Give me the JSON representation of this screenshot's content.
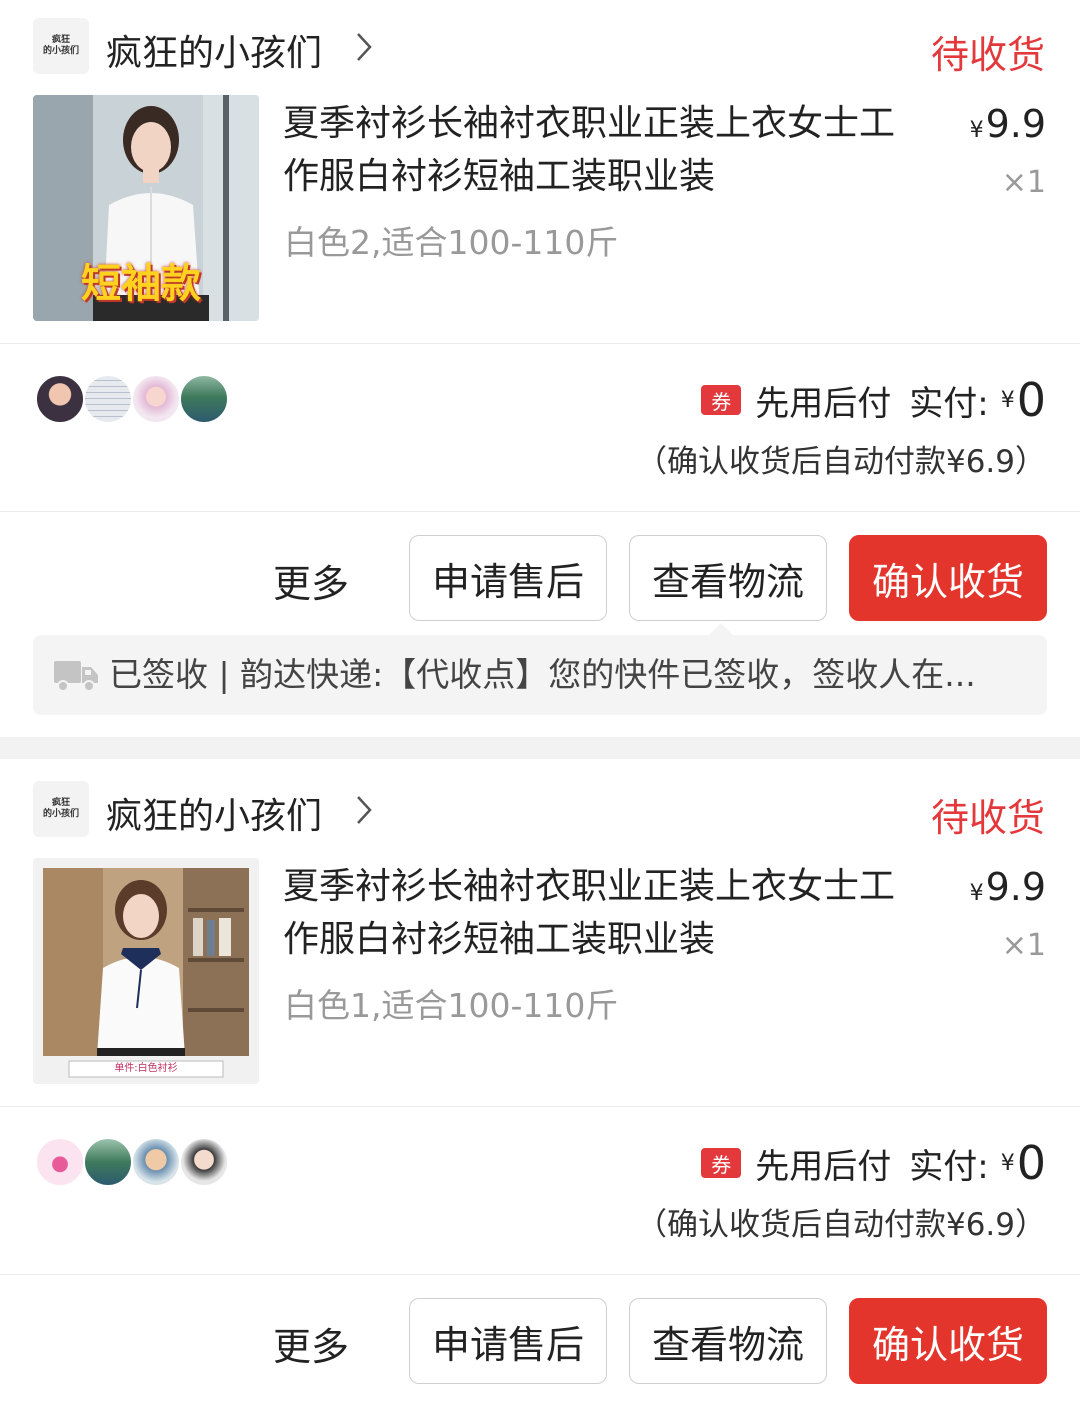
{
  "orders": [
    {
      "shop": {
        "logo_text": "疯狂\n的小孩们",
        "name": "疯狂的小孩们"
      },
      "status": "待收货",
      "product": {
        "title": "夏季衬衫长袖衬衣职业正装上衣女士工作服白衬衫短袖工装职业装",
        "variant": "白色2,适合100-110斤",
        "price_symbol": "¥",
        "price": "9.9",
        "quantity": "×1",
        "image_overlay_text": "短袖款"
      },
      "payment": {
        "coupon_badge": "券",
        "method": "先用后付",
        "actual_label": "实付:",
        "currency": "¥",
        "actual_value": "0",
        "auto_pay_note": "（确认收货后自动付款¥6.9）"
      },
      "actions": {
        "more": "更多",
        "after_sales": "申请售后",
        "logistics": "查看物流",
        "confirm": "确认收货"
      },
      "logistics_summary": "已签收 | 韵达快递:【代收点】您的快件已签收，签收人在..."
    },
    {
      "shop": {
        "logo_text": "疯狂\n的小孩们",
        "name": "疯狂的小孩们"
      },
      "status": "待收货",
      "product": {
        "title": "夏季衬衫长袖衬衣职业正装上衣女士工作服白衬衫短袖工装职业装",
        "variant": "白色1,适合100-110斤",
        "price_symbol": "¥",
        "price": "9.9",
        "quantity": "×1",
        "image_caption": "单件:白色衬衫"
      },
      "payment": {
        "coupon_badge": "券",
        "method": "先用后付",
        "actual_label": "实付:",
        "currency": "¥",
        "actual_value": "0",
        "auto_pay_note": "（确认收货后自动付款¥6.9）"
      },
      "actions": {
        "more": "更多",
        "after_sales": "申请售后",
        "logistics": "查看物流",
        "confirm": "确认收货"
      }
    }
  ],
  "colors": {
    "accent": "#e4393c",
    "button_primary": "#e4352c",
    "text": "#222222",
    "muted": "#999999"
  }
}
